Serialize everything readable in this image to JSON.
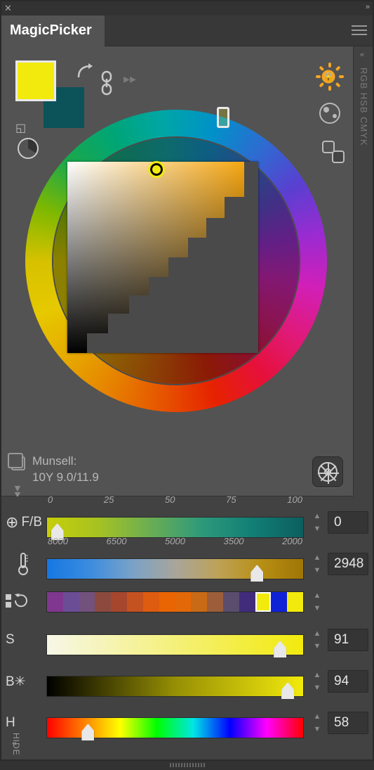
{
  "close_glyph": "✕",
  "expand_glyph": "»",
  "title": "MagicPicker",
  "side_modes": "RGB HSB CMYK",
  "swatch": {
    "fg": "#F2EA0C",
    "bg": "#0C5259"
  },
  "munsell": {
    "label": "Munsell:",
    "value": "10Y 9.0/11.9"
  },
  "sliders": {
    "fb": {
      "label": "F/B",
      "ticks": [
        "0",
        "25",
        "50",
        "75",
        "100"
      ],
      "value": "0",
      "thumb_pct": 4
    },
    "temp": {
      "ticks": [
        "8000",
        "6500",
        "5000",
        "3500",
        "2000"
      ],
      "value": "2948",
      "thumb_pct": 82
    },
    "s": {
      "label": "S",
      "value": "91",
      "thumb_pct": 91
    },
    "b": {
      "label": "B✳",
      "value": "94",
      "thumb_pct": 94
    },
    "h": {
      "label": "H",
      "value": "58",
      "thumb_pct": 16
    }
  },
  "swatch_strip": [
    "#803790",
    "#6B4D95",
    "#72527D",
    "#8C4A3E",
    "#A6472D",
    "#C45220",
    "#DD5C0F",
    "#E96504",
    "#E26808",
    "#C86A16",
    "#9C5E3A",
    "#5A4D6D",
    "#402C7A",
    "#F2EA0C",
    "#1022D6",
    "#F2EA0C"
  ],
  "hide_label": "HIDE"
}
